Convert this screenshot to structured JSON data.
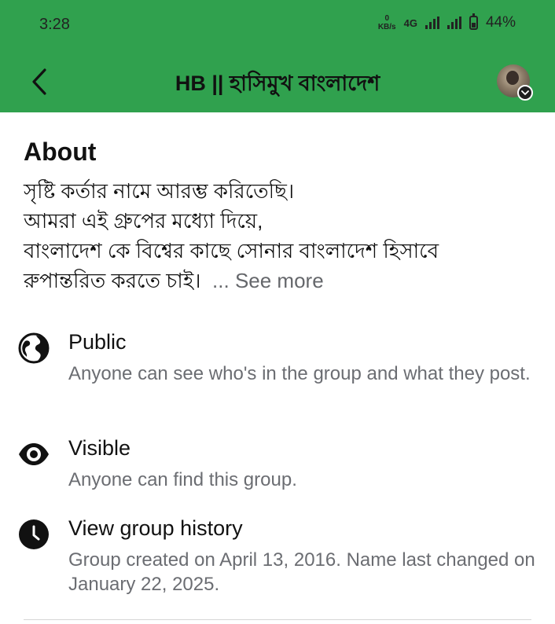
{
  "status_bar": {
    "time": "3:28",
    "data_rate_value": "0",
    "data_rate_unit": "KB/s",
    "network_type": "4G",
    "battery_percent": "44%",
    "battery_level": 0.44
  },
  "header": {
    "back_icon": "chevron-left-icon",
    "title": "HB || হাসিমুখ বাংলাদেশ",
    "avatar_badge_icon": "chevron-down-icon"
  },
  "about": {
    "heading": "About",
    "lines": [
      "সৃষ্টি কর্তার নামে আরম্ভ করিতেছি।",
      "আমরা এই গ্রুপের মধ্যো দিয়ে,",
      "বাংলাদেশ কে বিশ্বের কাছে সোনার বাংলাদেশ হিসাবে",
      "রুপান্তরিত করতে চাই।"
    ],
    "see_more_label": "... See more"
  },
  "info": [
    {
      "icon": "globe-icon",
      "title": "Public",
      "description": "Anyone can see who's in the group and what they post."
    },
    {
      "icon": "eye-icon",
      "title": "Visible",
      "description": "Anyone can find this group."
    },
    {
      "icon": "clock-icon",
      "title": "View group history",
      "description": "Group created on April 13, 2016. Name last changed on January 22, 2025."
    }
  ],
  "colors": {
    "brand_green": "#30a14e",
    "secondary_text": "#6b6d72"
  }
}
